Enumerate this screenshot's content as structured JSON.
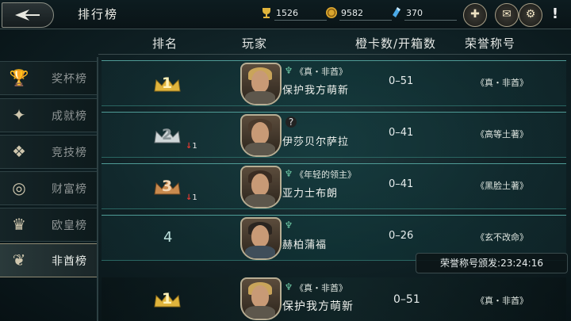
{
  "header": {
    "title": "排行榜",
    "resources": {
      "trophies": "1526",
      "coins": "9582",
      "gems": "370"
    }
  },
  "columns": {
    "rank": "排名",
    "player": "玩家",
    "stats": "橙卡数/开箱数",
    "honor": "荣誉称号"
  },
  "sidebar": {
    "items": [
      {
        "label": "奖杯榜",
        "icon": "chalice-icon"
      },
      {
        "label": "成就榜",
        "icon": "star-compass-icon"
      },
      {
        "label": "竞技榜",
        "icon": "arena-icon"
      },
      {
        "label": "财富榜",
        "icon": "coin-icon"
      },
      {
        "label": "欧皇榜",
        "icon": "crown-icon"
      },
      {
        "label": "非酋榜",
        "icon": "wreath-icon"
      }
    ],
    "active_index": 5
  },
  "rows": [
    {
      "rank": "1",
      "rank_change": "",
      "title": "《真・非酋》",
      "name": "保护我方萌新",
      "stats": "0–51",
      "honor": "《真・非酋》",
      "hair": "#c9a45a"
    },
    {
      "rank": "2",
      "rank_change": "1",
      "title": "",
      "name": "伊莎贝尔萨拉",
      "stats": "0–41",
      "honor": "《高等土著》",
      "hair": "#4a3a2c"
    },
    {
      "rank": "3",
      "rank_change": "1",
      "title": "《年轻的领主》",
      "name": "亚力士布朗",
      "stats": "0–41",
      "honor": "《黑脸土著》",
      "hair": "#3a2c22"
    },
    {
      "rank": "4",
      "rank_change": "",
      "title": "",
      "name": "赫柏蒲福",
      "stats": "0–26",
      "honor": "《玄不改命》",
      "hair": "#2b2520"
    }
  ],
  "timer": {
    "label": "荣誉称号颁发:",
    "time": "23:24:16"
  },
  "my_row": {
    "rank": "1",
    "title": "《真・非酋》",
    "name": "保护我方萌新",
    "stats": "0–51",
    "honor": "《真・非酋》"
  },
  "colors": {
    "accent_teal": "#4f9b96",
    "gold": "#e0b43c",
    "down_arrow": "#e03a32"
  }
}
